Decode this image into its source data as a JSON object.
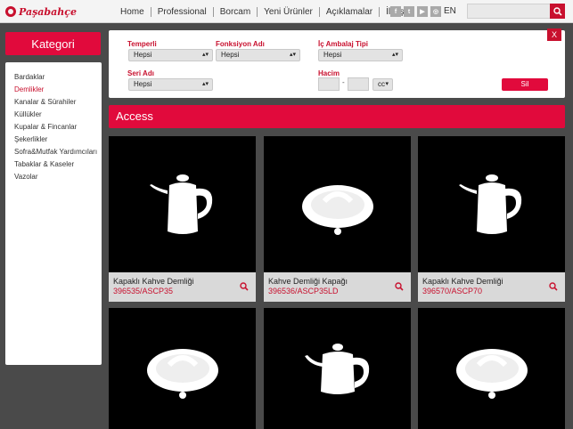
{
  "header": {
    "logo_text": "Paşabahçe",
    "nav": [
      "Home",
      "Professional",
      "Borcam",
      "Yeni Ürünler",
      "Açıklamalar",
      "İletişim"
    ],
    "social_icons": [
      "facebook-icon",
      "twitter-icon",
      "youtube-icon",
      "instagram-icon"
    ],
    "lang": "EN",
    "search_placeholder": ""
  },
  "sidebar": {
    "title": "Kategori",
    "items": [
      {
        "label": "Bardaklar",
        "active": false
      },
      {
        "label": "Demlikler",
        "active": true
      },
      {
        "label": "Kanalar & Sürahiler",
        "active": false
      },
      {
        "label": "Küllükler",
        "active": false
      },
      {
        "label": "Kupalar & Fincanlar",
        "active": false
      },
      {
        "label": "Şekerlikler",
        "active": false
      },
      {
        "label": "Sofra&Mutfak Yardımcıları",
        "active": false
      },
      {
        "label": "Tabaklar & Kaseler",
        "active": false
      },
      {
        "label": "Vazolar",
        "active": false
      }
    ]
  },
  "filter": {
    "temperli_label": "Temperli",
    "temperli_value": "Hepsi",
    "fonksiyon_label": "Fonksiyon Adı",
    "fonksiyon_value": "Hepsi",
    "ambalaj_label": "İç Ambalaj Tipi",
    "ambalaj_value": "Hepsi",
    "seri_label": "Seri Adı",
    "seri_value": "Hepsi",
    "hacim_label": "Hacim",
    "hacim_separator": "-",
    "hacim_unit": "cc",
    "clear_button": "Sil",
    "close_button": "X"
  },
  "banner": {
    "title": "Access"
  },
  "products": [
    {
      "name": "Kapaklı Kahve Demliği",
      "code": "396535/ASCP35",
      "image": "coffee-pot"
    },
    {
      "name": "Kahve Demliği Kapağı",
      "code": "396536/ASCP35LD",
      "image": "lid"
    },
    {
      "name": "Kapaklı Kahve Demliği",
      "code": "396570/ASCP70",
      "image": "coffee-pot"
    },
    {
      "name": "",
      "code": "",
      "image": "lid"
    },
    {
      "name": "",
      "code": "",
      "image": "teapot"
    },
    {
      "name": "",
      "code": "",
      "image": "lid"
    }
  ],
  "colors": {
    "brand": "#e10a3c",
    "accent": "#c8102e"
  }
}
